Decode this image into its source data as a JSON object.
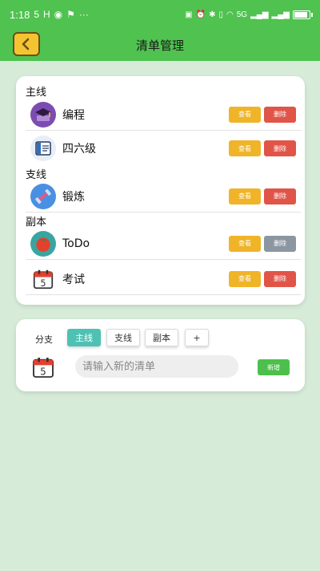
{
  "status_bar": {
    "time": "1:18",
    "left_icons": [
      "5",
      "H",
      "...",
      "..."
    ],
    "right_text": "5G"
  },
  "header": {
    "title": "清单管理"
  },
  "main_sections": [
    {
      "title": "主线",
      "items": [
        {
          "label": "编程",
          "icon": "graduation-cap-icon",
          "view": "查看",
          "delete": "删除"
        },
        {
          "label": "四六级",
          "icon": "book-icon",
          "view": "查看",
          "delete": "删除"
        }
      ]
    },
    {
      "title": "支线",
      "items": [
        {
          "label": "锻炼",
          "icon": "dumbbell-icon",
          "view": "查看",
          "delete": "删除"
        }
      ]
    },
    {
      "title": "副本",
      "items": [
        {
          "label": "ToDo",
          "icon": "tomato-icon",
          "view": "查看",
          "delete": "删除",
          "delete_disabled": true
        },
        {
          "label": "考试",
          "icon": "calendar-icon",
          "view": "查看",
          "delete": "删除"
        }
      ]
    }
  ],
  "new_list": {
    "branch_label": "分支",
    "chips": [
      "主线",
      "支线",
      "副本",
      "+"
    ],
    "active_chip": "主线",
    "input_placeholder": "请输入新的清单",
    "add_label": "新增"
  },
  "colors": {
    "green": "#4fc24f",
    "view_button": "#f0b429",
    "delete_button": "#e05548",
    "delete_disabled": "#8b96a0",
    "active_chip": "#4fc1b3"
  }
}
